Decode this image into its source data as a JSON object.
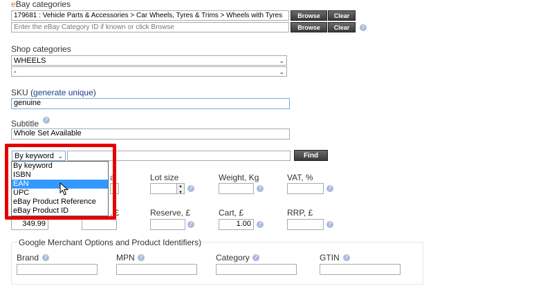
{
  "ebay_categories": {
    "label_first": "e",
    "label_rest": "Bay categories",
    "category_value": "179681 : Vehicle Parts & Accessories > Car Wheels, Tyres & Trims > Wheels with Tyres",
    "category_id_placeholder": "Enter the eBay Category ID if known or click Browse",
    "browse_label": "Browse",
    "clear_label": "Clear"
  },
  "shop_categories": {
    "label": "Shop categories",
    "select1_value": "WHEELS",
    "select2_value": "-"
  },
  "sku": {
    "label": "SKU (",
    "link": "generate unique",
    "label_end": ")",
    "value": "genuine"
  },
  "subtitle": {
    "label": "Subtitle",
    "value": "Whole Set Available"
  },
  "search": {
    "selected": "By keyword",
    "find_label": "Find",
    "options": [
      "By keyword",
      "ISBN",
      "EAN",
      "UPC",
      "eBay Product Reference",
      "eBay Product ID"
    ],
    "highlighted_index": 2
  },
  "row1": {
    "lot_size": "Lot size",
    "weight": "Weight, Kg",
    "vat": "VAT, %"
  },
  "row2": {
    "price_value": "349.99",
    "price_suffix": ", £",
    "reserve": "Reserve, £",
    "cart": "Cart, £",
    "cart_value": "1.00",
    "rrp": "RRP, £"
  },
  "google": {
    "title": "Google Merchant Options and Product Identifiers)",
    "brand": "Brand",
    "mpn": "MPN",
    "category": "Category",
    "gtin": "GTIN"
  },
  "icons": {
    "help": "help-icon",
    "cursor": "mouse-pointer-icon"
  }
}
